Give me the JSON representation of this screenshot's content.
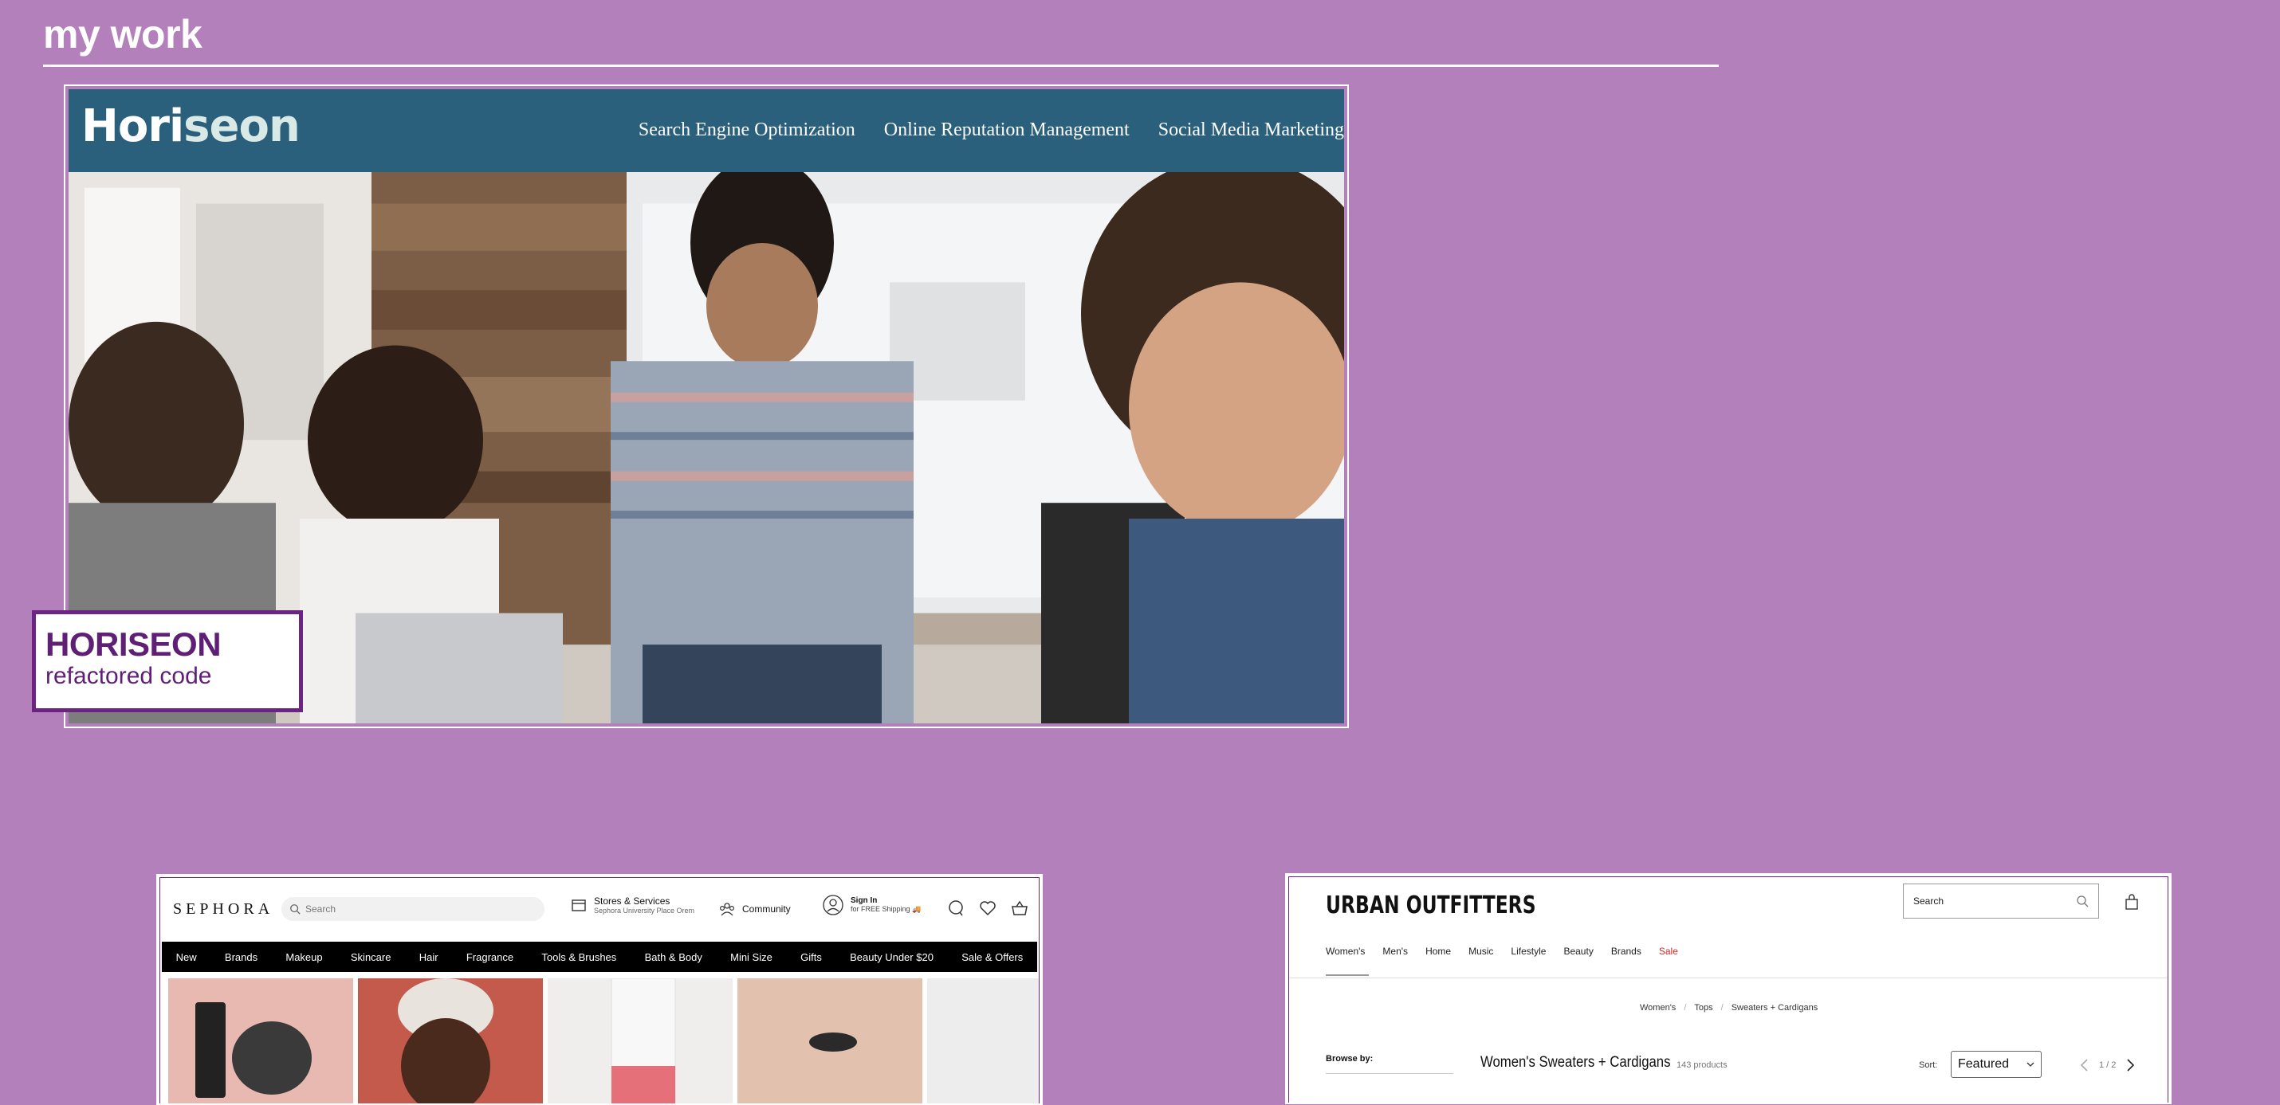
{
  "section": {
    "title": "my work"
  },
  "horiseon": {
    "logo_main": "Hori",
    "logo_accent": "seon",
    "nav": [
      "Search Engine Optimization",
      "Online Reputation Management",
      "Social Media Marketing"
    ],
    "caption_title": "HORISEON",
    "caption_subtitle": "refactored code"
  },
  "sephora": {
    "logo": "SEPHORA",
    "search_placeholder": "Search",
    "stores_title": "Stores & Services",
    "stores_subtitle": "Sephora University Place Orem",
    "community": "Community",
    "signin_title": "Sign In",
    "signin_subtitle": "for FREE Shipping 🚚",
    "nav": [
      "New",
      "Brands",
      "Makeup",
      "Skincare",
      "Hair",
      "Fragrance",
      "Tools & Brushes",
      "Bath & Body",
      "Mini Size",
      "Gifts",
      "Beauty Under $20",
      "Sale & Offers"
    ]
  },
  "urban": {
    "logo": "URBAN OUTFITTERS",
    "search_placeholder": "Search",
    "nav": [
      "Women's",
      "Men's",
      "Home",
      "Music",
      "Lifestyle",
      "Beauty",
      "Brands"
    ],
    "nav_sale": "Sale",
    "crumbs": [
      "Women's",
      "Tops",
      "Sweaters + Cardigans"
    ],
    "browse_label": "Browse by:",
    "page_title": "Women's Sweaters + Cardigans",
    "product_count": "143 products",
    "sort_label": "Sort:",
    "sort_value": "Featured",
    "pager": "1 / 2"
  },
  "colors": {
    "background": "#b380bb",
    "horiseon_header": "#2a607c",
    "caption_purple": "#5e1f74",
    "uo_sale": "#d82828"
  },
  "icons": [
    "search-icon",
    "store-icon",
    "community-icon",
    "user-icon",
    "chat-icon",
    "heart-icon",
    "basket-icon",
    "bag-icon",
    "chevron-left-icon",
    "chevron-right-icon",
    "chevron-down-icon"
  ]
}
